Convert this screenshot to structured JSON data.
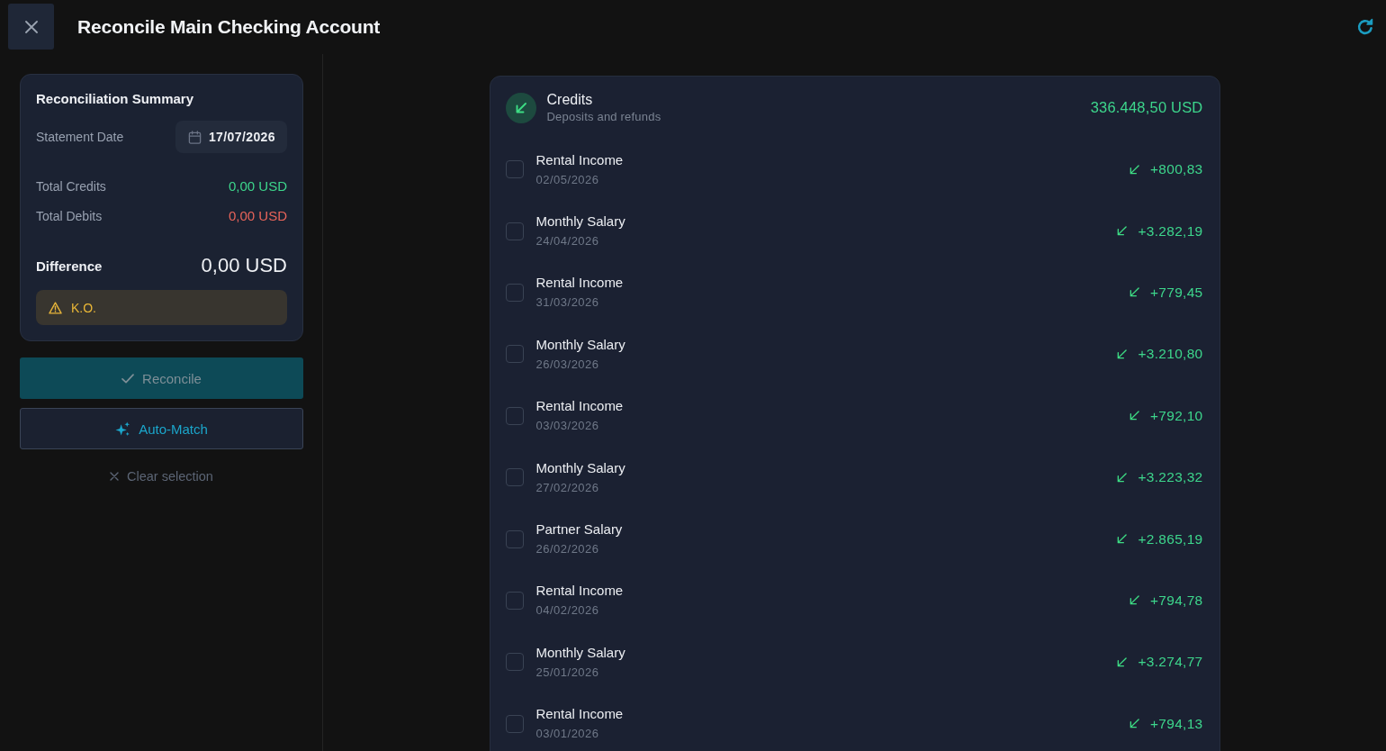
{
  "header": {
    "title": "Reconcile Main Checking Account"
  },
  "summary": {
    "title": "Reconciliation Summary",
    "statement_date": {
      "label": "Statement Date",
      "value": "17/07/2026"
    },
    "totals": [
      {
        "kind": "credit",
        "label": "Total Credits",
        "value": "0,00 USD"
      },
      {
        "kind": "debit",
        "label": "Total Debits",
        "value": "0,00 USD"
      }
    ],
    "difference": {
      "label": "Difference",
      "value": "0,00 USD"
    },
    "status": {
      "kind": "warning",
      "text": "K.O."
    }
  },
  "actions": [
    {
      "kind": "primary",
      "label": "Reconcile",
      "disabled": true
    },
    {
      "kind": "secondary",
      "label": "Auto-Match",
      "disabled": false
    }
  ],
  "clear_selection": {
    "label": "Clear selection"
  },
  "credits": {
    "title": "Credits",
    "subtitle": "Deposits and refunds",
    "total": "336.448,50 USD",
    "transactions": [
      {
        "name": "Rental Income",
        "date": "02/05/2026",
        "amount": "+800,83",
        "checked": false
      },
      {
        "name": "Monthly Salary",
        "date": "24/04/2026",
        "amount": "+3.282,19",
        "checked": false
      },
      {
        "name": "Rental Income",
        "date": "31/03/2026",
        "amount": "+779,45",
        "checked": false
      },
      {
        "name": "Monthly Salary",
        "date": "26/03/2026",
        "amount": "+3.210,80",
        "checked": false
      },
      {
        "name": "Rental Income",
        "date": "03/03/2026",
        "amount": "+792,10",
        "checked": false
      },
      {
        "name": "Monthly Salary",
        "date": "27/02/2026",
        "amount": "+3.223,32",
        "checked": false
      },
      {
        "name": "Partner Salary",
        "date": "26/02/2026",
        "amount": "+2.865,19",
        "checked": false
      },
      {
        "name": "Rental Income",
        "date": "04/02/2026",
        "amount": "+794,78",
        "checked": false
      },
      {
        "name": "Monthly Salary",
        "date": "25/01/2026",
        "amount": "+3.274,77",
        "checked": false
      },
      {
        "name": "Rental Income",
        "date": "03/01/2026",
        "amount": "+794,13",
        "checked": false
      }
    ]
  }
}
